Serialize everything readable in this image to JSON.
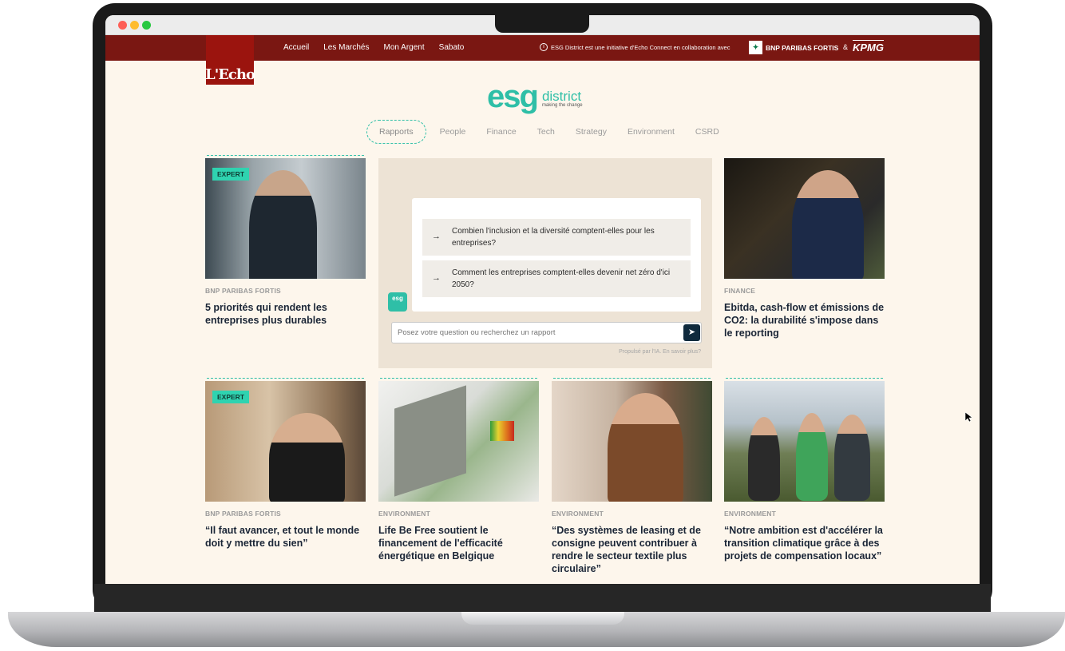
{
  "browser": {
    "title": ""
  },
  "topnav": {
    "logo": "L'Echo",
    "links": [
      "Accueil",
      "Les Marchés",
      "Mon Argent",
      "Sabato"
    ],
    "notice": "ESG District est une initiative d'Echo Connect en collaboration avec",
    "partner1": "BNP PARIBAS FORTIS",
    "amp": "&",
    "partner2": "KPMG"
  },
  "brand": {
    "mark": "esg",
    "name": "district",
    "tagline": "making the change"
  },
  "tabs": [
    "Rapports",
    "People",
    "Finance",
    "Tech",
    "Strategy",
    "Environment",
    "CSRD"
  ],
  "active_tab": "Rapports",
  "ai": {
    "suggestions": [
      "Combien l'inclusion et la diversité comptent-elles pour les entreprises?",
      "Comment les entreprises comptent-elles devenir net zéro d'ici 2050?"
    ],
    "mini_logo": "esg",
    "placeholder": "Posez votre question ou recherchez un rapport",
    "powered": "Propulsé par l'IA. En savoir plus?"
  },
  "cards": [
    {
      "badge": "EXPERT",
      "category": "BNP PARIBAS FORTIS",
      "title": "5 priorités qui rendent les entreprises plus durables"
    },
    {
      "badge": "",
      "category": "FINANCE",
      "title": "Ebitda, cash-flow et émissions de CO2: la durabilité s'impose dans le reporting"
    },
    {
      "badge": "EXPERT",
      "category": "BNP PARIBAS FORTIS",
      "title": "“Il faut avancer, et tout le monde doit y mettre du sien”"
    },
    {
      "badge": "",
      "category": "ENVIRONMENT",
      "title": "Life Be Free soutient le financement de l'efficacité énergétique en Belgique"
    },
    {
      "badge": "",
      "category": "ENVIRONMENT",
      "title": "“Des systèmes de leasing et de consigne peuvent contribuer à rendre le secteur textile plus circulaire”"
    },
    {
      "badge": "",
      "category": "ENVIRONMENT",
      "title": "“Notre ambition est d'accélérer la transition climatique grâce à des projets de compensation locaux”"
    }
  ]
}
